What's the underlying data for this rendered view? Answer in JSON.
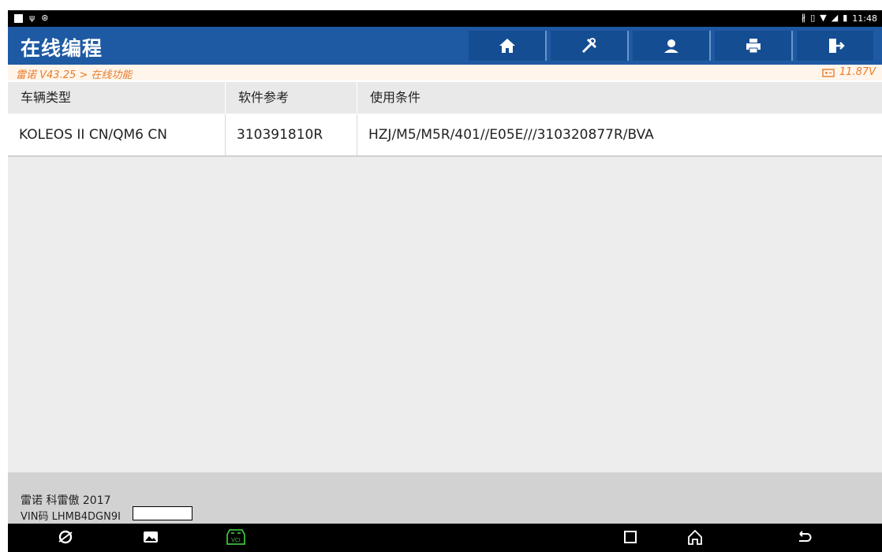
{
  "status_bar": {
    "left_icons": [
      "image-icon",
      "usb-icon",
      "bug-icon"
    ],
    "right_icons": [
      "bluetooth-icon",
      "vibrate-icon",
      "wifi-icon",
      "signal-icon",
      "battery-icon"
    ],
    "time": "11:48"
  },
  "header": {
    "title": "在线编程",
    "buttons": [
      "home-icon",
      "tools-icon",
      "support-icon",
      "print-icon",
      "exit-icon"
    ],
    "bg_color": "#1e5aa3"
  },
  "breadcrumb": {
    "text": "雷诺 V43.25 > 在线功能",
    "voltage": "11.87V",
    "color": "#e87b2c"
  },
  "table": {
    "columns": [
      "车辆类型",
      "软件参考",
      "使用条件"
    ],
    "rows": [
      [
        "KOLEOS II CN/QM6 CN",
        "310391810R",
        "HZJ/M5/M5R/401//E05E///310320877R/BVA"
      ]
    ]
  },
  "footer": {
    "vehicle": "雷诺 科雷傲 2017",
    "vin_label": "VIN码 LHMB4DGN9I"
  },
  "nav_bar": {
    "icons": [
      "browser-icon",
      "gallery-icon",
      "vci-icon",
      "recents-icon",
      "home-nav-icon",
      "back-icon"
    ],
    "vci_color": "#3dbd3d"
  }
}
